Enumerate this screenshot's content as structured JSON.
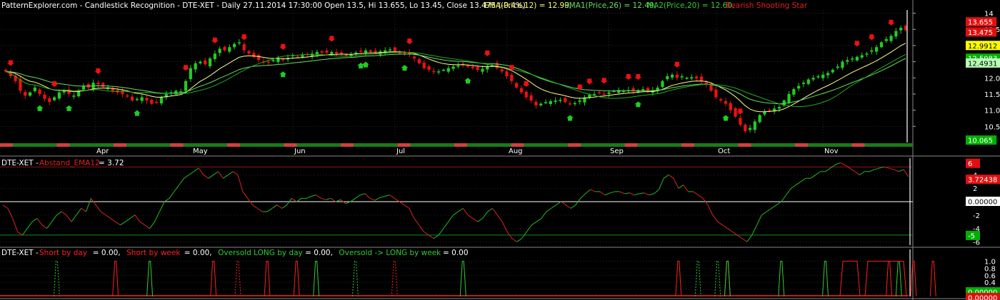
{
  "header": {
    "source": "PatternExplorer.com - Candlestick Recognition - DTE-XET - Daily 27.11.2014 17:30:00 Open 13.5, Hi 13.655, Lo 13.45, Close 13.475 (-0.4%)",
    "ema12": "EMA(Price,12) = 12.99,",
    "ema26": "EMA1(Price,26) = 12.49,",
    "ma20": "MA2(Price,20) = 12.60,",
    "pattern": "Bearish Shooting Star"
  },
  "pane2": {
    "prefix": "DTE-XET -",
    "name": "Abstand_EMA12",
    "value": "= 3.72"
  },
  "pane3": {
    "prefix": "DTE-XET -",
    "items": [
      {
        "name": "Short by day",
        "value": "= 0.00,",
        "color": "#ff2020"
      },
      {
        "name": "Short by week",
        "value": "= 0.00,",
        "color": "#ff2020"
      },
      {
        "name": "Oversold LONG by day",
        "value": "= 0.00,",
        "color": "#33cc33"
      },
      {
        "name": "Oversold -> LONG by week",
        "value": "= 0.00",
        "color": "#33cc33"
      }
    ]
  },
  "months": [
    "Apr",
    "May",
    "Jun",
    "Jul",
    "Aug",
    "Sep",
    "Oct",
    "Nov"
  ],
  "price_axis": {
    "ticks": [
      "14",
      "13.5",
      "13.0",
      "12.5",
      "12.0",
      "11.5",
      "11.0",
      "10.5"
    ],
    "badges": [
      {
        "text": "13.655",
        "bg": "#e01010",
        "fg": "#ffffff"
      },
      {
        "text": "13.475",
        "bg": "#e01010",
        "fg": "#ffffff"
      },
      {
        "text": "12.9912",
        "bg": "#ffff00",
        "fg": "#000000"
      },
      {
        "text": "12.5983",
        "bg": "#00b000",
        "fg": "#ffffff"
      },
      {
        "text": "12.4931",
        "bg": "#b8ffb8",
        "fg": "#000000"
      },
      {
        "text": "10.065",
        "bg": "#00b000",
        "fg": "#ffffff"
      }
    ]
  },
  "osc_axis": {
    "ticks": [
      "4",
      "2",
      "-2",
      "-4",
      "-6"
    ],
    "badges": [
      {
        "text": "6",
        "bg": "#e01010",
        "fg": "#ffffff"
      },
      {
        "text": "3.72438",
        "bg": "#e01010",
        "fg": "#ffffff"
      },
      {
        "text": "0.00000",
        "bg": "#ffffff",
        "fg": "#000000"
      },
      {
        "text": "-5",
        "bg": "#00b000",
        "fg": "#ffffff"
      }
    ]
  },
  "signal_axis": {
    "ticks": [
      "1.0",
      "0.8",
      "0.6",
      "0.4",
      "0.2"
    ],
    "badges": [
      {
        "text": "0.00000",
        "bg": "#00b000",
        "fg": "#ffffff"
      },
      {
        "text": "0.00000",
        "bg": "#e01010",
        "fg": "#ffffff"
      },
      {
        "text": "0.00000",
        "bg": "#e01010",
        "fg": "#ffffff"
      }
    ]
  },
  "colors": {
    "up": "#22cc22",
    "down": "#ee1111",
    "ema12": "#ffff88",
    "ema26": "#66dd66",
    "ma20": "#22aa22",
    "grid": "#444444",
    "osc": "#33cc33",
    "signal_red": "#ff2020",
    "signal_green": "#33cc33"
  },
  "chart_data": [
    {
      "type": "candlestick",
      "title": "DTE-XET Daily",
      "month_starts": {
        "Apr": 0.3,
        "May": 0.7,
        "Jun": 1.6,
        "Jul": 2.5,
        "Aug": 3.5,
        "Sep": 3.9,
        "Oct": 4.6,
        "Nov": 5.4
      },
      "close": [
        12.2,
        12.05,
        11.9,
        11.6,
        11.45,
        11.55,
        11.7,
        11.5,
        11.35,
        11.25,
        11.4,
        11.55,
        11.6,
        11.5,
        11.45,
        11.62,
        11.75,
        11.7,
        11.85,
        11.8,
        11.72,
        11.7,
        11.6,
        11.55,
        11.5,
        11.42,
        11.3,
        11.35,
        11.4,
        11.3,
        11.2,
        11.25,
        11.4,
        11.5,
        11.55,
        11.6,
        11.58,
        11.9,
        12.3,
        12.45,
        12.5,
        12.42,
        12.6,
        12.75,
        12.9,
        12.85,
        12.95,
        13.05,
        13.1,
        12.85,
        12.75,
        12.65,
        12.55,
        12.5,
        12.48,
        12.55,
        12.6,
        12.55,
        12.62,
        12.7,
        12.65,
        12.7,
        12.72,
        12.75,
        12.8,
        12.78,
        12.78,
        12.8,
        12.75,
        12.78,
        12.7,
        12.72,
        12.78,
        12.82,
        12.85,
        12.8,
        12.78,
        12.82,
        12.85,
        12.88,
        12.82,
        12.78,
        12.75,
        12.72,
        12.6,
        12.45,
        12.3,
        12.25,
        12.2,
        12.2,
        12.25,
        12.3,
        12.35,
        12.38,
        12.42,
        12.35,
        12.3,
        12.25,
        12.28,
        12.35,
        12.4,
        12.3,
        12.2,
        12.05,
        11.9,
        11.7,
        11.55,
        11.4,
        11.3,
        11.15,
        11.2,
        11.25,
        11.28,
        11.3,
        11.32,
        11.25,
        11.2,
        11.22,
        11.3,
        11.4,
        11.48,
        11.5,
        11.55,
        11.5,
        11.55,
        11.6,
        11.62,
        11.6,
        11.62,
        11.6,
        11.62,
        11.65,
        11.6,
        11.62,
        11.7,
        11.9,
        12.05,
        12.1,
        12.0,
        12.05,
        12.0,
        12.02,
        11.98,
        11.9,
        11.8,
        11.6,
        11.4,
        11.3,
        11.2,
        11.0,
        10.8,
        10.55,
        10.35,
        10.45,
        10.65,
        10.85,
        10.95,
        11.0,
        11.05,
        11.1,
        11.3,
        11.5,
        11.65,
        11.75,
        11.85,
        11.95,
        12.0,
        12.05,
        12.1,
        12.15,
        12.25,
        12.35,
        12.5,
        12.55,
        12.6,
        12.65,
        12.7,
        12.75,
        12.85,
        12.95,
        13.1,
        13.2,
        13.3,
        13.45,
        13.55,
        13.475
      ],
      "indicators": {
        "EMA(Price,12)": 12.99,
        "EMA1(Price,26)": 12.49,
        "MA2(Price,20)": 12.6
      },
      "ylim": [
        10.0,
        14.1
      ]
    },
    {
      "type": "line",
      "title": "Abstand_EMA12",
      "ylim": [
        -6.5,
        6.5
      ],
      "values": [
        -0.5,
        -1,
        -2.5,
        -4.5,
        -5,
        -4,
        -3,
        -2.5,
        -3.5,
        -4,
        -3,
        -2,
        -1.5,
        -2,
        -3,
        -2,
        -1,
        -1.5,
        0.5,
        -0.5,
        -1.5,
        -2,
        -2.5,
        -3,
        -3.5,
        -3,
        -2.5,
        -2,
        -3,
        -3.5,
        -4,
        -3,
        -1.5,
        0,
        0.5,
        1.5,
        2.5,
        3.5,
        4,
        4.5,
        5,
        4,
        3.5,
        4,
        4.5,
        3.5,
        4,
        4.5,
        4,
        1.5,
        0.5,
        -0.5,
        -1,
        -1.5,
        -1.5,
        -1,
        -0.5,
        -1,
        -0.5,
        0.5,
        0,
        0.5,
        0.5,
        0.8,
        1,
        0.5,
        0.3,
        0.5,
        0,
        0.3,
        -0.3,
        0,
        0.5,
        1,
        1.2,
        0.5,
        0.2,
        0.6,
        0.8,
        1,
        0.5,
        0,
        -0.5,
        -1,
        -2.5,
        -3.5,
        -4.5,
        -5,
        -5.5,
        -5,
        -4,
        -3,
        -2,
        -1.5,
        -1,
        -2,
        -2.5,
        -3,
        -2.5,
        -1.5,
        -1,
        -2,
        -3,
        -4.5,
        -5.5,
        -6,
        -5.5,
        -4.5,
        -3.5,
        -3,
        -2.5,
        -1.5,
        -1,
        -0.5,
        0,
        -0.5,
        -1,
        -0.5,
        0.5,
        1.2,
        1.8,
        1.5,
        1.5,
        1,
        1.3,
        1.5,
        1.5,
        1.2,
        1.3,
        1,
        1.2,
        1.3,
        1,
        1.2,
        1.8,
        3.5,
        4,
        3.5,
        2,
        2.5,
        1.5,
        1.5,
        1,
        0.5,
        -0.5,
        -2,
        -3,
        -3.5,
        -4,
        -4.5,
        -5,
        -5.5,
        -6,
        -5,
        -3.5,
        -2,
        -1.5,
        -1,
        -0.5,
        0,
        1,
        2,
        2.5,
        3,
        3.5,
        3.5,
        4,
        4.5,
        4.5,
        5,
        5.5,
        5.8,
        5.5,
        5,
        4.5,
        4,
        4.5,
        4.5,
        4.8,
        5,
        5.2,
        5,
        4.8,
        4.5,
        4.8,
        3.72
      ]
    },
    {
      "type": "line",
      "title": "Signals",
      "ylim": [
        0,
        1.05
      ],
      "series": [
        {
          "name": "Short by day",
          "spikes": [
            23,
            43,
            54,
            60,
            138,
            148,
            181,
            186,
            190
          ]
        },
        {
          "name": "Short by week",
          "spikes": [
            48,
            80
          ]
        },
        {
          "name": "Oversold LONG by day",
          "spikes": [
            30,
            64,
            94,
            148,
            159,
            168,
            183
          ]
        },
        {
          "name": "Oversold -> LONG by week",
          "spikes": [
            11,
            72,
            142,
            146
          ]
        }
      ]
    }
  ]
}
